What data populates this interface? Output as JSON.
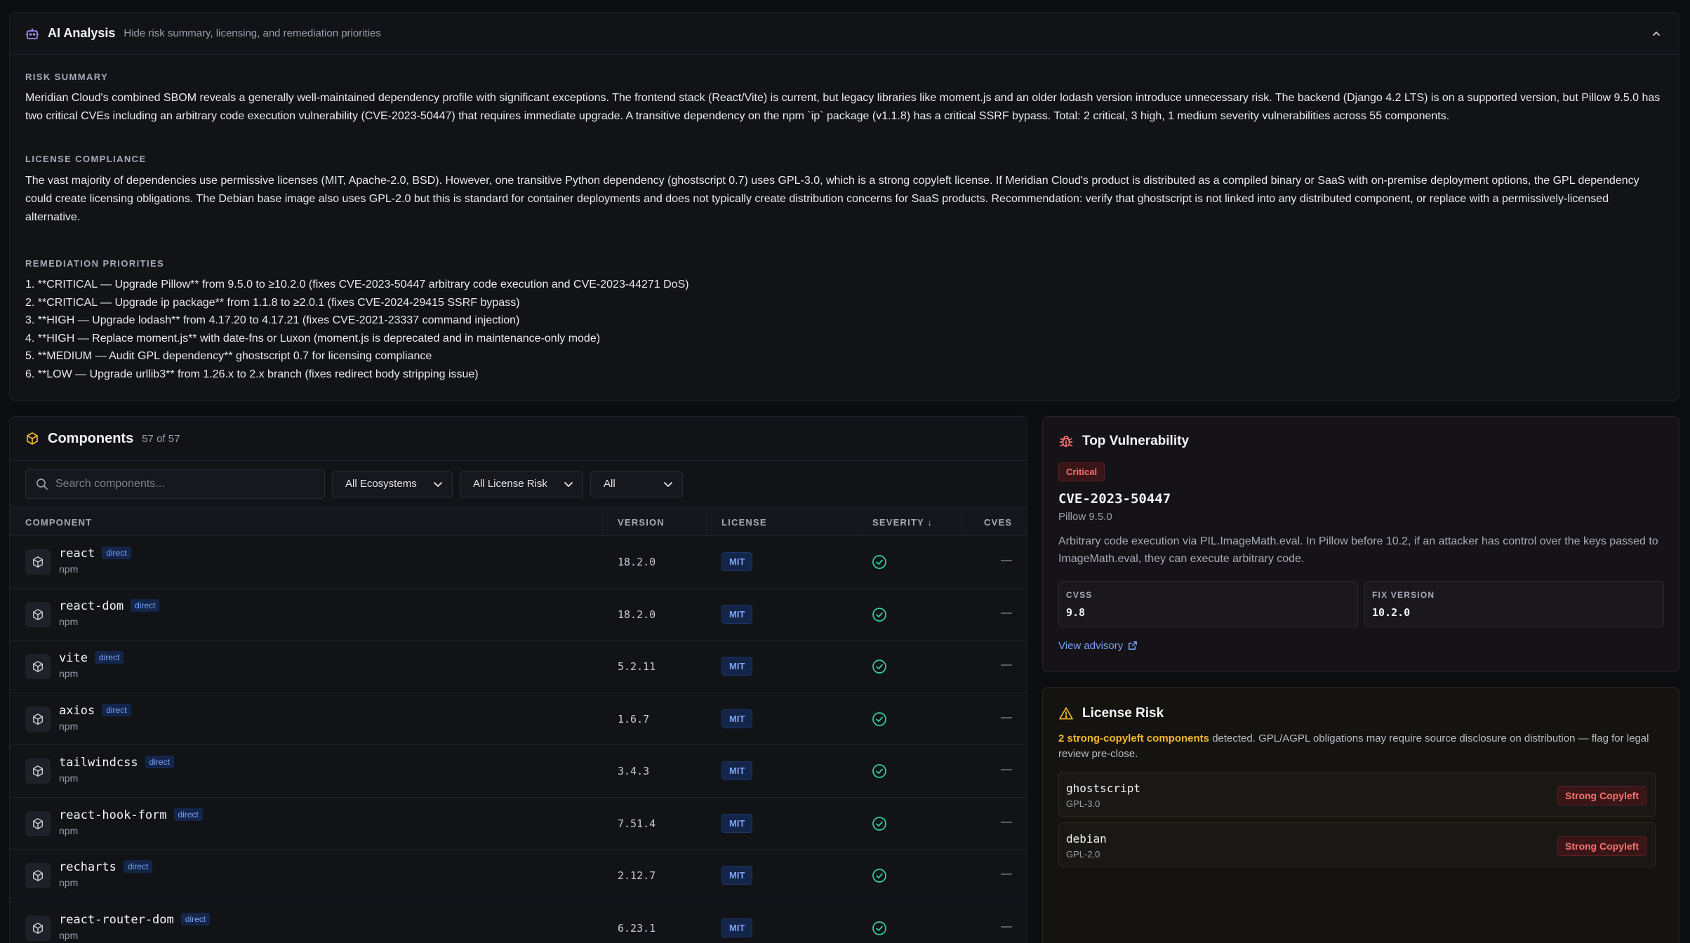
{
  "ai": {
    "title": "AI Analysis",
    "subtitle": "Hide risk summary, licensing, and remediation priorities",
    "risk_label": "RISK SUMMARY",
    "risk_text": "Meridian Cloud's combined SBOM reveals a generally well-maintained dependency profile with significant exceptions. The frontend stack (React/Vite) is current, but legacy libraries like moment.js and an older lodash version introduce unnecessary risk. The backend (Django 4.2 LTS) is on a supported version, but Pillow 9.5.0 has two critical CVEs including an arbitrary code execution vulnerability (CVE-2023-50447) that requires immediate upgrade. A transitive dependency on the npm `ip` package (v1.1.8) has a critical SSRF bypass. Total: 2 critical, 3 high, 1 medium severity vulnerabilities across 55 components.",
    "license_label": "LICENSE COMPLIANCE",
    "license_text": "The vast majority of dependencies use permissive licenses (MIT, Apache-2.0, BSD). However, one transitive Python dependency (ghostscript 0.7) uses GPL-3.0, which is a strong copyleft license. If Meridian Cloud's product is distributed as a compiled binary or SaaS with on-premise deployment options, the GPL dependency could create licensing obligations. The Debian base image also uses GPL-2.0 but this is standard for container deployments and does not typically create distribution concerns for SaaS products. Recommendation: verify that ghostscript is not linked into any distributed component, or replace with a permissively-licensed alternative.",
    "remediation_label": "REMEDIATION PRIORITIES",
    "priorities": [
      "1. **CRITICAL — Upgrade Pillow** from 9.5.0 to ≥10.2.0 (fixes CVE-2023-50447 arbitrary code execution and CVE-2023-44271 DoS)",
      "2. **CRITICAL — Upgrade ip package** from 1.1.8 to ≥2.0.1 (fixes CVE-2024-29415 SSRF bypass)",
      "3. **HIGH — Upgrade lodash** from 4.17.20 to 4.17.21 (fixes CVE-2021-23337 command injection)",
      "4. **HIGH — Replace moment.js** with date-fns or Luxon (moment.js is deprecated and in maintenance-only mode)",
      "5. **MEDIUM — Audit GPL dependency** ghostscript 0.7 for licensing compliance",
      "6. **LOW — Upgrade urllib3** from 1.26.x to 2.x branch (fixes redirect body stripping issue)"
    ]
  },
  "components": {
    "title": "Components",
    "count": "57 of 57",
    "search_placeholder": "Search components...",
    "filters": {
      "ecosystem": "All Ecosystems",
      "license_risk": "All License Risk",
      "severity": "All"
    },
    "columns": {
      "component": "COMPONENT",
      "version": "VERSION",
      "license": "LICENSE",
      "severity": "SEVERITY ↓",
      "cves": "CVES"
    },
    "rows": [
      {
        "name": "react",
        "badge": "direct",
        "ecosystem": "npm",
        "version": "18.2.0",
        "license": "MIT",
        "cves": "—"
      },
      {
        "name": "react-dom",
        "badge": "direct",
        "ecosystem": "npm",
        "version": "18.2.0",
        "license": "MIT",
        "cves": "—"
      },
      {
        "name": "vite",
        "badge": "direct",
        "ecosystem": "npm",
        "version": "5.2.11",
        "license": "MIT",
        "cves": "—"
      },
      {
        "name": "axios",
        "badge": "direct",
        "ecosystem": "npm",
        "version": "1.6.7",
        "license": "MIT",
        "cves": "—"
      },
      {
        "name": "tailwindcss",
        "badge": "direct",
        "ecosystem": "npm",
        "version": "3.4.3",
        "license": "MIT",
        "cves": "—"
      },
      {
        "name": "react-hook-form",
        "badge": "direct",
        "ecosystem": "npm",
        "version": "7.51.4",
        "license": "MIT",
        "cves": "—"
      },
      {
        "name": "recharts",
        "badge": "direct",
        "ecosystem": "npm",
        "version": "2.12.7",
        "license": "MIT",
        "cves": "—"
      },
      {
        "name": "react-router-dom",
        "badge": "direct",
        "ecosystem": "npm",
        "version": "6.23.1",
        "license": "MIT",
        "cves": "—"
      }
    ]
  },
  "vuln": {
    "title": "Top Vulnerability",
    "severity": "Critical",
    "cve": "CVE-2023-50447",
    "package": "Pillow 9.5.0",
    "description": "Arbitrary code execution via PIL.ImageMath.eval. In Pillow before 10.2, if an attacker has control over the keys passed to ImageMath.eval, they can execute arbitrary code.",
    "cvss_label": "CVSS",
    "cvss": "9.8",
    "fix_label": "FIX VERSION",
    "fix": "10.2.0",
    "advisory": "View advisory"
  },
  "license_risk": {
    "title": "License Risk",
    "highlight": "2 strong-copyleft components",
    "text": " detected. GPL/AGPL obligations may require source disclosure on distribution — flag for legal review pre-close.",
    "items": [
      {
        "name": "ghostscript",
        "license": "GPL-3.0",
        "tag": "Strong Copyleft"
      },
      {
        "name": "debian",
        "license": "GPL-2.0",
        "tag": "Strong Copyleft"
      }
    ]
  },
  "colors": {
    "accent": "#7aa2f7",
    "critical": "#f87171",
    "warning": "#f5b82e",
    "ok": "#34d399",
    "ai": "#a78bfa"
  },
  "icons": {
    "ai": "robot-icon",
    "components": "package-icon",
    "vuln": "bug-icon",
    "license": "warning-triangle-icon",
    "ok": "check-circle-icon"
  }
}
